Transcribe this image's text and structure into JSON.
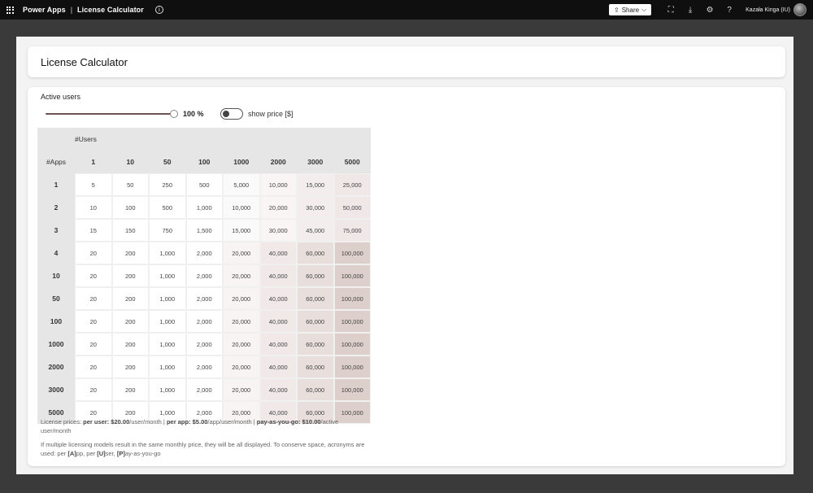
{
  "topbar": {
    "app_name": "Power Apps",
    "separator": "|",
    "app_title": "License Calculator",
    "share_label": "Share",
    "user_name": "Kazała Kinga (IU)"
  },
  "header": {
    "title": "License Calculator"
  },
  "controls": {
    "active_users_label": "Active users",
    "slider_value": "100 %",
    "slider_level_percent": 100,
    "toggle_label": "show price [$]",
    "toggle_on": false
  },
  "table": {
    "users_label": "#Users",
    "apps_label": "#Apps",
    "columns": [
      "1",
      "10",
      "50",
      "100",
      "1000",
      "2000",
      "3000",
      "5000"
    ],
    "rows": [
      {
        "apps": "1",
        "values": [
          "5",
          "50",
          "250",
          "500",
          "5,000",
          "10,000",
          "15,000",
          "25,000"
        ]
      },
      {
        "apps": "2",
        "values": [
          "10",
          "100",
          "500",
          "1,000",
          "10,000",
          "20,000",
          "30,000",
          "50,000"
        ]
      },
      {
        "apps": "3",
        "values": [
          "15",
          "150",
          "750",
          "1,500",
          "15,000",
          "30,000",
          "45,000",
          "75,000"
        ]
      },
      {
        "apps": "4",
        "values": [
          "20",
          "200",
          "1,000",
          "2,000",
          "20,000",
          "40,000",
          "60,000",
          "100,000"
        ]
      },
      {
        "apps": "10",
        "values": [
          "20",
          "200",
          "1,000",
          "2,000",
          "20,000",
          "40,000",
          "60,000",
          "100,000"
        ]
      },
      {
        "apps": "50",
        "values": [
          "20",
          "200",
          "1,000",
          "2,000",
          "20,000",
          "40,000",
          "60,000",
          "100,000"
        ]
      },
      {
        "apps": "100",
        "values": [
          "20",
          "200",
          "1,000",
          "2,000",
          "20,000",
          "40,000",
          "60,000",
          "100,000"
        ]
      },
      {
        "apps": "1000",
        "values": [
          "20",
          "200",
          "1,000",
          "2,000",
          "20,000",
          "40,000",
          "60,000",
          "100,000"
        ]
      },
      {
        "apps": "2000",
        "values": [
          "20",
          "200",
          "1,000",
          "2,000",
          "20,000",
          "40,000",
          "60,000",
          "100,000"
        ]
      },
      {
        "apps": "3000",
        "values": [
          "20",
          "200",
          "1,000",
          "2,000",
          "20,000",
          "40,000",
          "60,000",
          "100,000"
        ]
      },
      {
        "apps": "5000",
        "values": [
          "20",
          "200",
          "1,000",
          "2,000",
          "20,000",
          "40,000",
          "60,000",
          "100,000"
        ]
      }
    ]
  },
  "notes": {
    "prices_prefix": "License prices: ",
    "per_user_label": "per user: ",
    "per_user_price": "$20.00",
    "per_user_unit": "/user/month | ",
    "per_app_label": "per app: ",
    "per_app_price": "$5.00",
    "per_app_unit": "/app/user/month | ",
    "payg_label": "pay-as-you-go: ",
    "payg_price": "$10.00",
    "payg_unit": "/active user/month",
    "multi_prefix": "If multiple licensing models result in the same monthly price, they will be all displayed. To conserve space, acronyms are used: per ",
    "acr_a": "[A]",
    "acr_a_rest": "pp, per ",
    "acr_u": "[U]",
    "acr_u_rest": "ser, ",
    "acr_p": "[P]",
    "acr_p_rest": "ay-as-you-go"
  },
  "colors": {
    "topbar_bg": "#0f0f0f",
    "slider_fill": "#6b5054",
    "heat_high": "#dcc8c5"
  }
}
